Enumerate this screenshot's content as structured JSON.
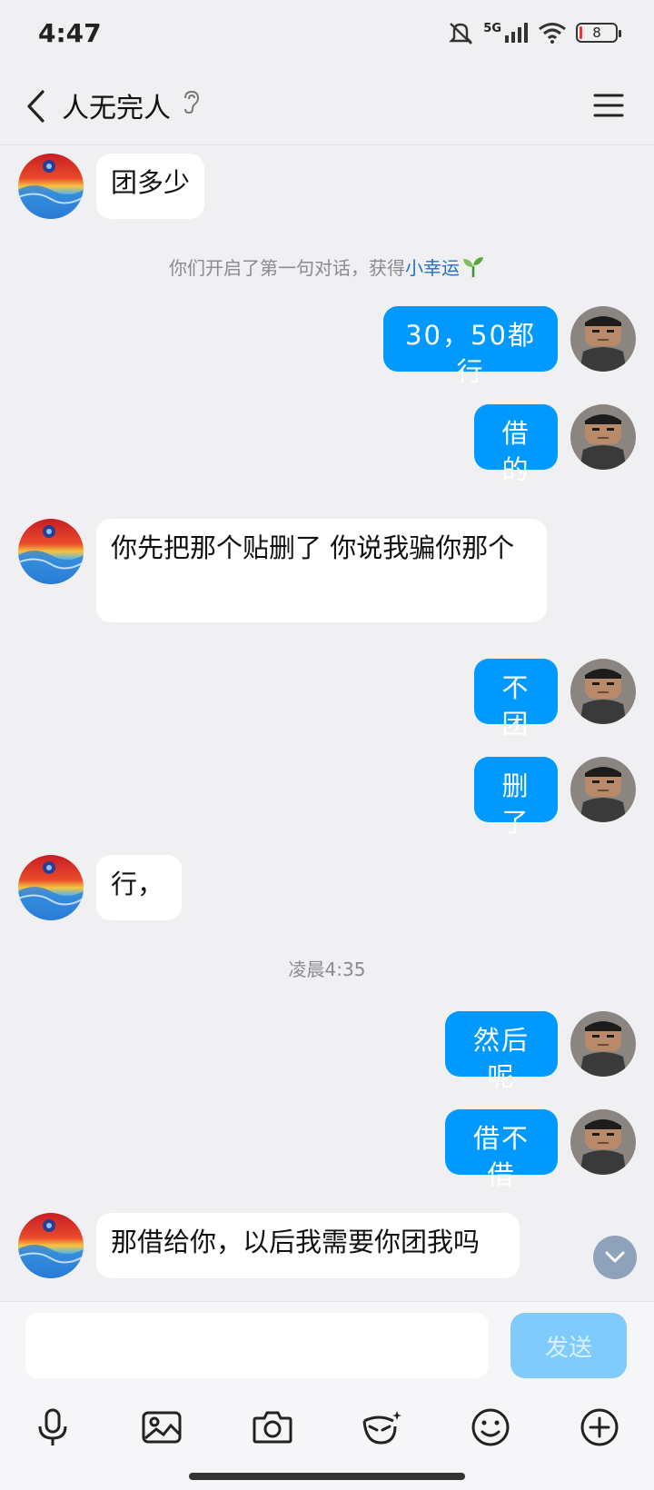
{
  "status": {
    "time": "4:47",
    "network": "5G",
    "battery": "8"
  },
  "header": {
    "title": "人无完人",
    "ear_icon": "ear-icon",
    "menu_icon": "menu-icon"
  },
  "messages": [
    {
      "side": "left",
      "text": "团多少"
    },
    {
      "side": "right",
      "text": "30，50都行"
    },
    {
      "side": "right",
      "text": "借的"
    },
    {
      "side": "left",
      "text": "你先把那个贴删了 你说我骗你那个"
    },
    {
      "side": "right",
      "text": "不团"
    },
    {
      "side": "right",
      "text": "删了"
    },
    {
      "side": "left",
      "text": "行，"
    },
    {
      "side": "right",
      "text": "然后呢"
    },
    {
      "side": "right",
      "text": "借不借"
    },
    {
      "side": "left",
      "text": "那借给你，以后我需要你团我吗"
    }
  ],
  "system": {
    "first_talk_prefix": "你们开启了第一句对话，获得",
    "first_talk_link": "小幸运",
    "timestamp": "凌晨4:35"
  },
  "input": {
    "placeholder": "",
    "send_label": "发送"
  },
  "toolbar": [
    "microphone-icon",
    "image-icon",
    "camera-icon",
    "sticker-icon",
    "emoji-icon",
    "plus-icon"
  ],
  "colors": {
    "bubble_sent": "#0099ff",
    "bubble_received": "#ffffff",
    "background": "#f0f0f2",
    "send_disabled": "#7fcbfb"
  }
}
